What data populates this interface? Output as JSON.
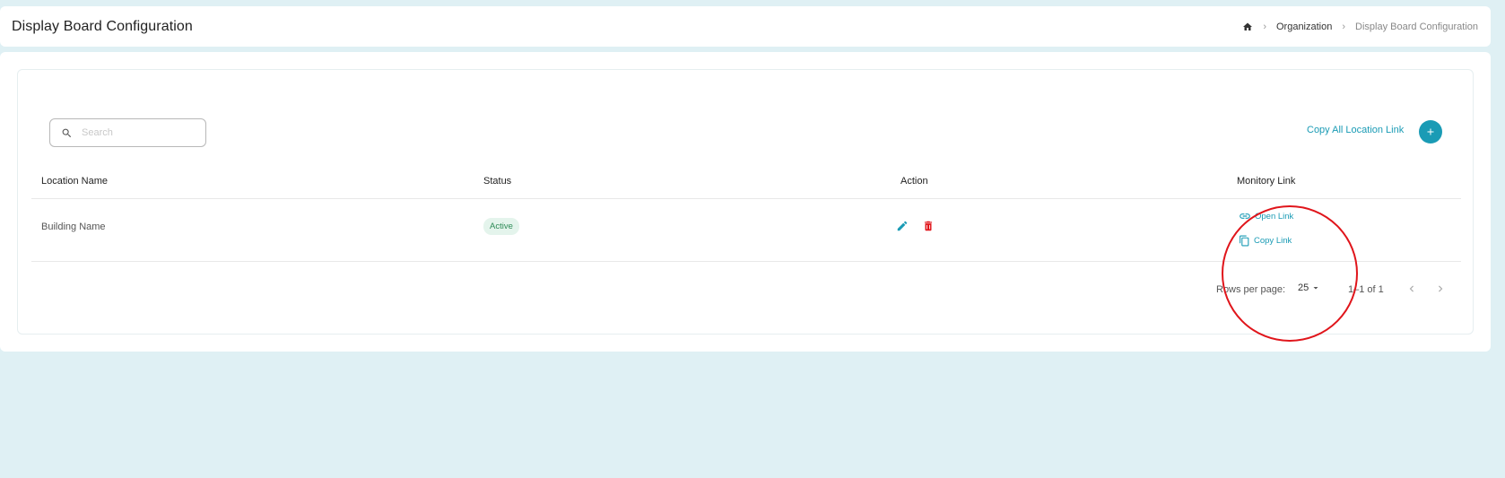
{
  "header": {
    "title": "Display Board Configuration",
    "breadcrumb": {
      "home_icon": "home-icon",
      "separator": "›",
      "items": [
        {
          "label": "Organization"
        },
        {
          "label": "Display Board Configuration"
        }
      ]
    }
  },
  "toolbar": {
    "search_placeholder": "Search",
    "search_value": "",
    "copy_all_label": "Copy All Location Link",
    "add_icon": "plus-icon"
  },
  "table": {
    "columns": [
      "Location Name",
      "Status",
      "Action",
      "Monitory Link"
    ],
    "rows": [
      {
        "location_name": "Building Name",
        "status": "Active",
        "actions": [
          "edit-icon",
          "delete-icon"
        ],
        "links": {
          "open_label": "Open Link",
          "copy_label": "Copy Link"
        }
      }
    ]
  },
  "pagination": {
    "rows_per_page_label": "Rows per page:",
    "rows_per_page_value": "25",
    "range_text": "1–1 of 1"
  },
  "colors": {
    "accent": "#1a9bb5",
    "danger": "#e0151b",
    "success": "#2e8b57",
    "background": "#dff0f4"
  }
}
